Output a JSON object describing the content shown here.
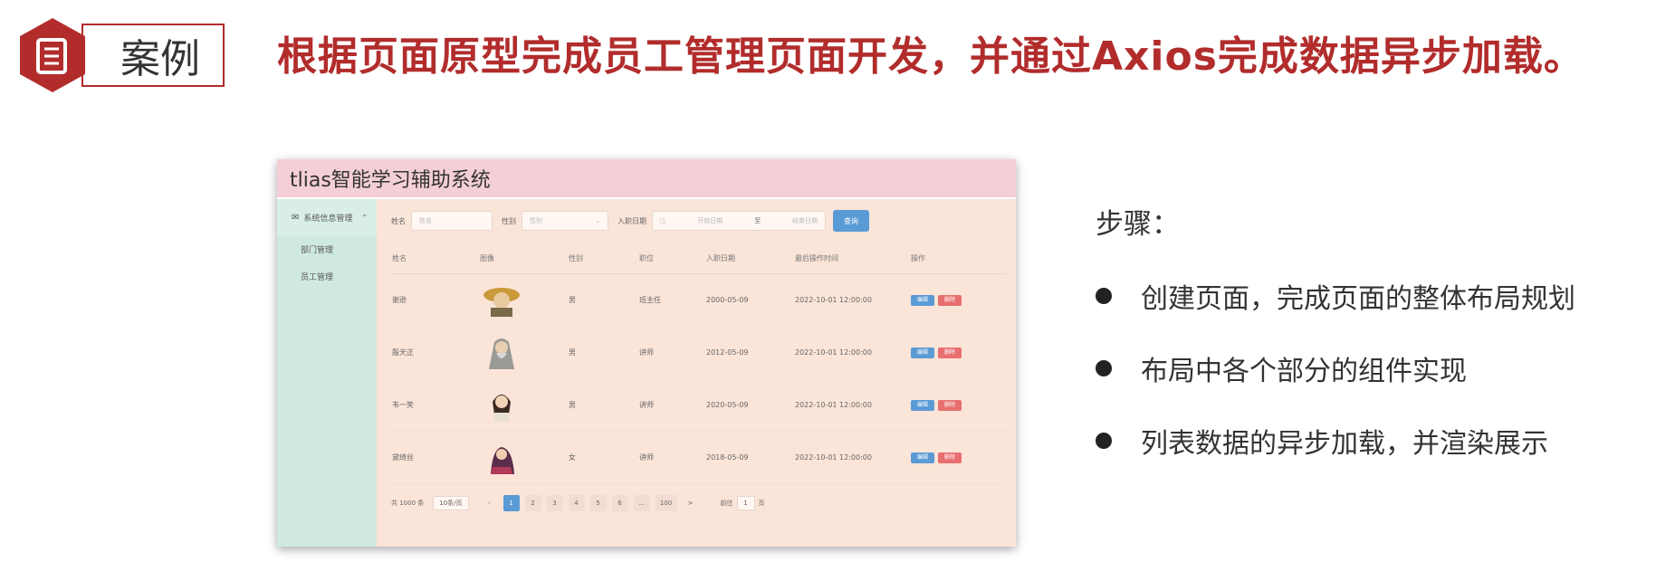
{
  "header": {
    "badge_icon": "document-icon",
    "case_label": "案例",
    "title": "根据页面原型完成员工管理页面开发，并通过Axios完成数据异步加载。",
    "accent_color": "#b22c2c"
  },
  "app": {
    "title": "tlias智能学习辅助系统",
    "sidebar": {
      "group_label": "系统信息管理",
      "items": [
        {
          "label": "部门管理"
        },
        {
          "label": "员工管理"
        }
      ]
    },
    "search": {
      "name_label": "姓名",
      "name_placeholder": "姓名",
      "gender_label": "性别",
      "gender_placeholder": "性别",
      "date_label": "入职日期",
      "date_start_placeholder": "开始日期",
      "date_separator": "至",
      "date_end_placeholder": "结束日期",
      "query_button": "查询"
    },
    "table": {
      "headers": [
        "姓名",
        "图像",
        "性别",
        "职位",
        "入职日期",
        "最后操作时间",
        "操作"
      ],
      "rows": [
        {
          "name": "谢逊",
          "gender": "男",
          "position": "班主任",
          "entry_date": "2000-05-09",
          "update_time": "2022-10-01 12:00:00"
        },
        {
          "name": "殷天正",
          "gender": "男",
          "position": "讲师",
          "entry_date": "2012-05-09",
          "update_time": "2022-10-01 12:00:00"
        },
        {
          "name": "韦一笑",
          "gender": "男",
          "position": "讲师",
          "entry_date": "2020-05-09",
          "update_time": "2022-10-01 12:00:00"
        },
        {
          "name": "黛绮丝",
          "gender": "女",
          "position": "讲师",
          "entry_date": "2018-05-09",
          "update_time": "2022-10-01 12:00:00"
        }
      ],
      "edit_label": "编辑",
      "delete_label": "删除"
    },
    "pagination": {
      "total": "共 1000 条",
      "page_size": "10条/页",
      "prev": "<",
      "pages": [
        "1",
        "2",
        "3",
        "4",
        "5",
        "6",
        "...",
        "100"
      ],
      "next": ">",
      "goto_label": "前往",
      "goto_value": "1",
      "goto_suffix": "页"
    }
  },
  "steps": {
    "title": "步骤：",
    "items": [
      {
        "text": "创建页面，完成页面的整体布局规划"
      },
      {
        "text": "布局中各个部分的组件实现"
      },
      {
        "text": "列表数据的异步加载，并渲染展示"
      }
    ]
  }
}
